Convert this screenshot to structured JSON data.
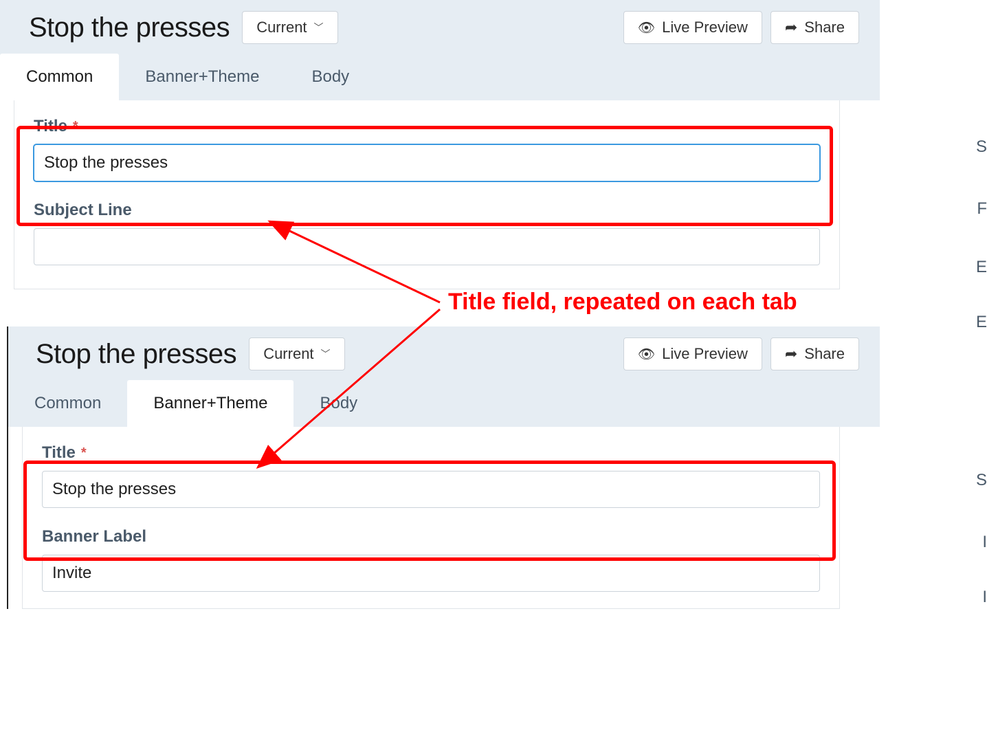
{
  "annotation": {
    "text": "Title field, repeated on each tab"
  },
  "panel1": {
    "title": "Stop the presses",
    "version_button": "Current",
    "live_preview": "Live Preview",
    "share": "Share",
    "tabs": {
      "common": "Common",
      "banner": "Banner+Theme",
      "body": "Body"
    },
    "fields": {
      "title_label": "Title",
      "title_value": "Stop the presses",
      "subject_label": "Subject Line",
      "subject_value": ""
    }
  },
  "panel2": {
    "title": "Stop the presses",
    "version_button": "Current",
    "live_preview": "Live Preview",
    "share": "Share",
    "tabs": {
      "common": "Common",
      "banner": "Banner+Theme",
      "body": "Body"
    },
    "fields": {
      "title_label": "Title",
      "title_value": "Stop the presses",
      "banner_label_label": "Banner Label",
      "banner_label_value": "Invite"
    }
  }
}
